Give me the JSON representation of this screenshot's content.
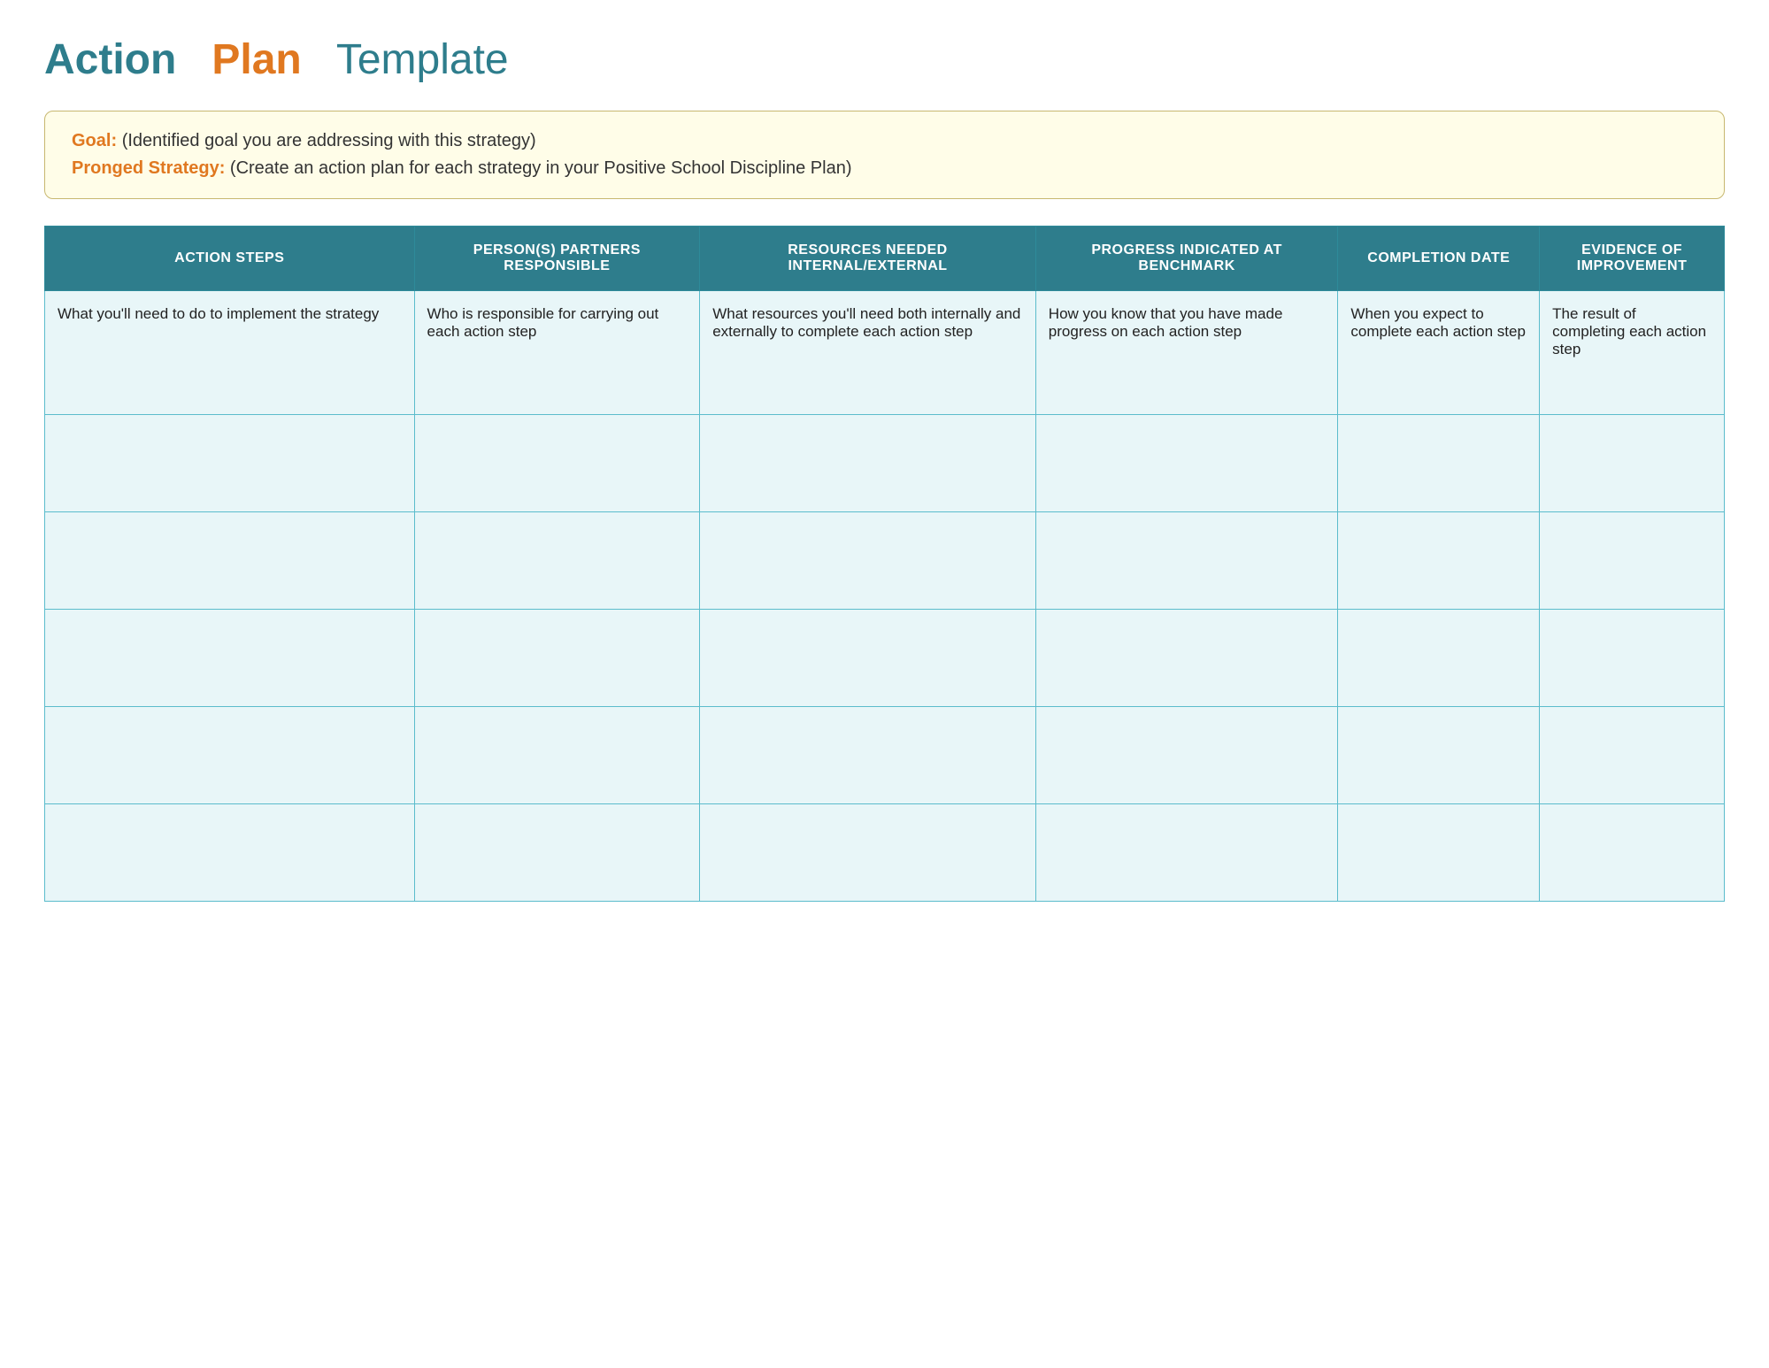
{
  "title": {
    "action": "Action",
    "plan": "Plan",
    "template": "Template"
  },
  "goal_box": {
    "goal_label": "Goal:",
    "goal_text": "(Identified goal you are addressing with this strategy)",
    "pronged_label": "Pronged Strategy:",
    "pronged_text": " (Create an action plan for each strategy in your Positive School Discipline Plan)"
  },
  "table": {
    "headers": {
      "action_steps": "ACTION STEPS",
      "persons_responsible": "PERSON(S) PARTNERS RESPONSIBLE",
      "resources_needed": "RESOURCES NEEDED INTERNAL/EXTERNAL",
      "progress_indicated": "PROGRESS INDICATED AT BENCHMARK",
      "completion_date": "COMPLETION DATE",
      "evidence_improvement": "EVIDENCE OF IMPROVEMENT"
    },
    "first_row": {
      "action_steps": "What you'll need to do to implement the strategy",
      "persons_responsible": "Who is responsible for carrying out each action step",
      "resources_needed": "What resources you'll need both internally and externally to complete each action step",
      "progress_indicated": "How you know that you have made progress on each action step",
      "completion_date": "When you expect to complete each action step",
      "evidence_improvement": "The result of completing each action step"
    }
  }
}
